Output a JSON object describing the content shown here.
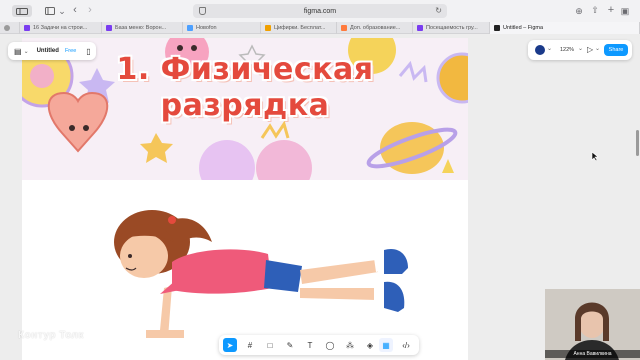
{
  "browser": {
    "url": "figma.com",
    "tabs": [
      {
        "label": "",
        "color": "#9a9a9a"
      },
      {
        "label": "16 Задачи на строи...",
        "color": "#7a3df0"
      },
      {
        "label": "База меню: Ворон...",
        "color": "#7a3df0"
      },
      {
        "label": "Новоfon",
        "color": "#4da0ff"
      },
      {
        "label": "Цифирки. Бесплат...",
        "color": "#f0a000"
      },
      {
        "label": "Доп. образование...",
        "color": "#ff7a3d"
      },
      {
        "label": "Посещаемость гру...",
        "color": "#7a3df0"
      },
      {
        "label": "Untitled – Figma",
        "color": "#222222"
      }
    ]
  },
  "figma": {
    "file_name": "Untitled",
    "plan_badge": "Free",
    "zoom": "122%",
    "share_label": "Share",
    "accent": "#0d99ff"
  },
  "slide": {
    "title_line1": "1. Физическая",
    "title_line2": "разрядка",
    "title_color": "#e44a3d"
  },
  "overlay": {
    "watermark": "Контур Толк",
    "webcam_name": "Анна Вавилкина"
  }
}
